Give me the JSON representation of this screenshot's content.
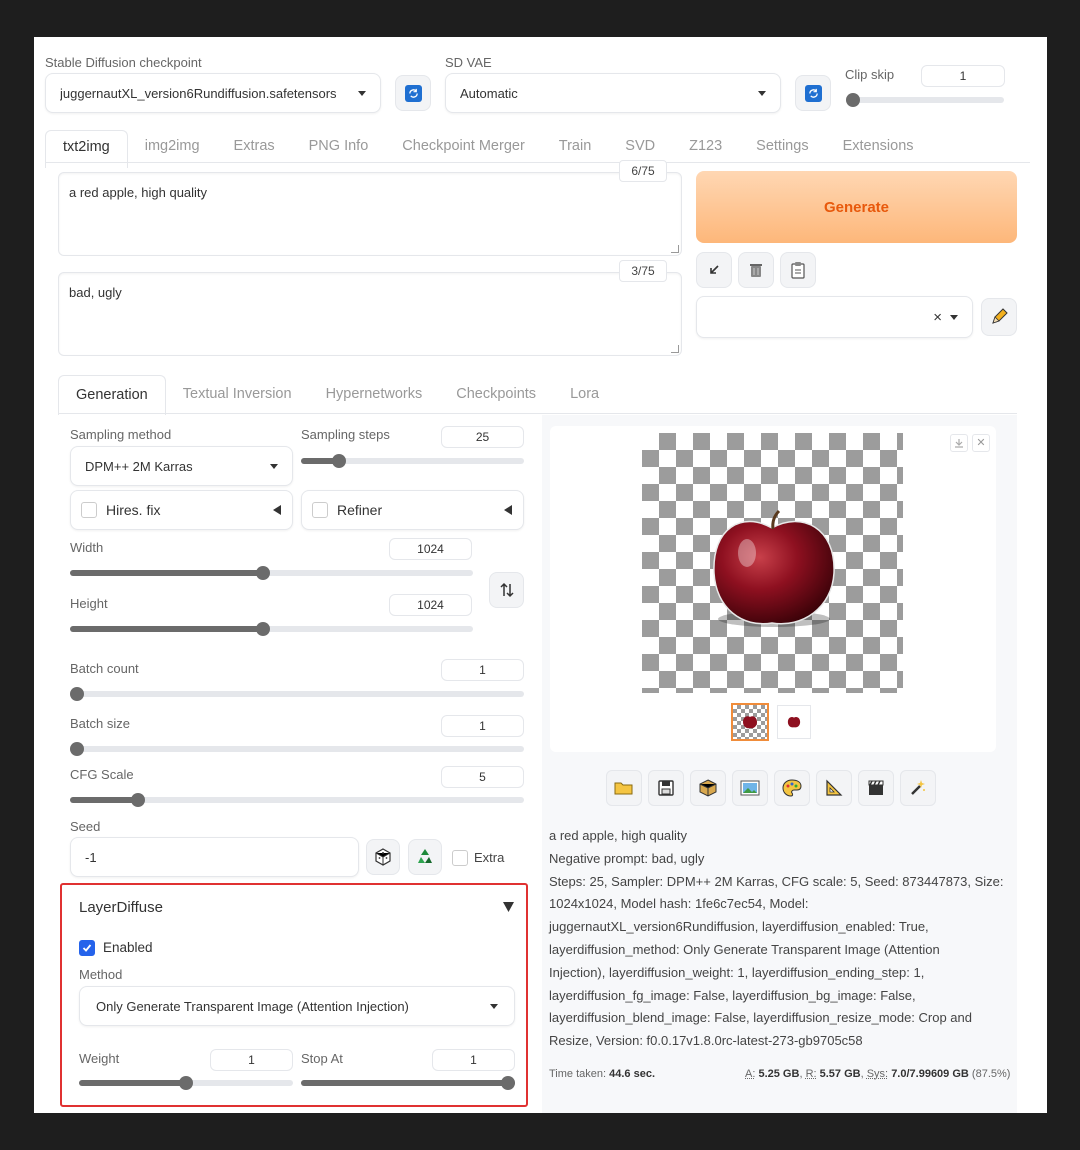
{
  "checkpoint": {
    "label": "Stable Diffusion checkpoint",
    "value": "juggernautXL_version6Rundiffusion.safetensors"
  },
  "vae": {
    "label": "SD VAE",
    "value": "Automatic"
  },
  "clip_skip": {
    "label": "Clip skip",
    "value": "1",
    "fraction": 0.0
  },
  "top_tabs": [
    "txt2img",
    "img2img",
    "Extras",
    "PNG Info",
    "Checkpoint Merger",
    "Train",
    "SVD",
    "Z123",
    "Settings",
    "Extensions"
  ],
  "prompt": {
    "value": "a red apple, high quality",
    "counter": "6/75"
  },
  "negative_prompt": {
    "value": "bad, ugly",
    "counter": "3/75"
  },
  "generate_label": "Generate",
  "style_clear_glyph": "×",
  "sub_tabs": [
    "Generation",
    "Textual Inversion",
    "Hypernetworks",
    "Checkpoints",
    "Lora"
  ],
  "sampling_method": {
    "label": "Sampling method",
    "value": "DPM++ 2M Karras"
  },
  "sampling_steps": {
    "label": "Sampling steps",
    "value": "25",
    "fraction": 0.17
  },
  "hires": {
    "label": "Hires. fix"
  },
  "refiner": {
    "label": "Refiner"
  },
  "width": {
    "label": "Width",
    "value": "1024",
    "fraction": 0.48
  },
  "height": {
    "label": "Height",
    "value": "1024",
    "fraction": 0.48
  },
  "batch_count": {
    "label": "Batch count",
    "value": "1",
    "fraction": 0.0
  },
  "batch_size": {
    "label": "Batch size",
    "value": "1",
    "fraction": 0.0
  },
  "cfg_scale": {
    "label": "CFG Scale",
    "value": "5",
    "fraction": 0.15
  },
  "seed": {
    "label": "Seed",
    "value": "-1",
    "extra_label": "Extra"
  },
  "layerdiffuse": {
    "title": "LayerDiffuse",
    "enabled_label": "Enabled",
    "method_label": "Method",
    "method_value": "Only Generate Transparent Image (Attention Injection)",
    "weight": {
      "label": "Weight",
      "value": "1",
      "fraction": 0.5
    },
    "stop_at": {
      "label": "Stop At",
      "value": "1",
      "fraction": 1.0
    }
  },
  "output": {
    "info_lines": [
      "a red apple, high quality",
      "Negative prompt: bad, ugly",
      "Steps: 25, Sampler: DPM++ 2M Karras, CFG scale: 5, Seed: 873447873, Size:",
      "1024x1024, Model hash: 1fe6c7ec54, Model:",
      "juggernautXL_version6Rundiffusion, layerdiffusion_enabled: True,",
      "layerdiffusion_method: Only Generate Transparent Image (Attention",
      "Injection), layerdiffusion_weight: 1, layerdiffusion_ending_step: 1,",
      "layerdiffusion_fg_image: False, layerdiffusion_bg_image: False,",
      "layerdiffusion_blend_image: False, layerdiffusion_resize_mode: Crop and",
      "Resize, Version: f0.0.17v1.8.0rc-latest-273-gb9705c58"
    ],
    "time_label": "Time taken:",
    "time_value": "44.6 sec.",
    "mem": {
      "a_label": "A:",
      "a": "5.25 GB",
      "r_label": "R:",
      "r": "5.57 GB",
      "sys_label": "Sys:",
      "sys": "7.0/7.99609 GB",
      "pct": "(87.5%)"
    }
  },
  "colors": {
    "generate_start": "#ffd7b3",
    "generate_end": "#fdb77a",
    "generate_text": "#e8590c",
    "highlight_border": "#e03131",
    "accent_blue": "#2563eb"
  }
}
